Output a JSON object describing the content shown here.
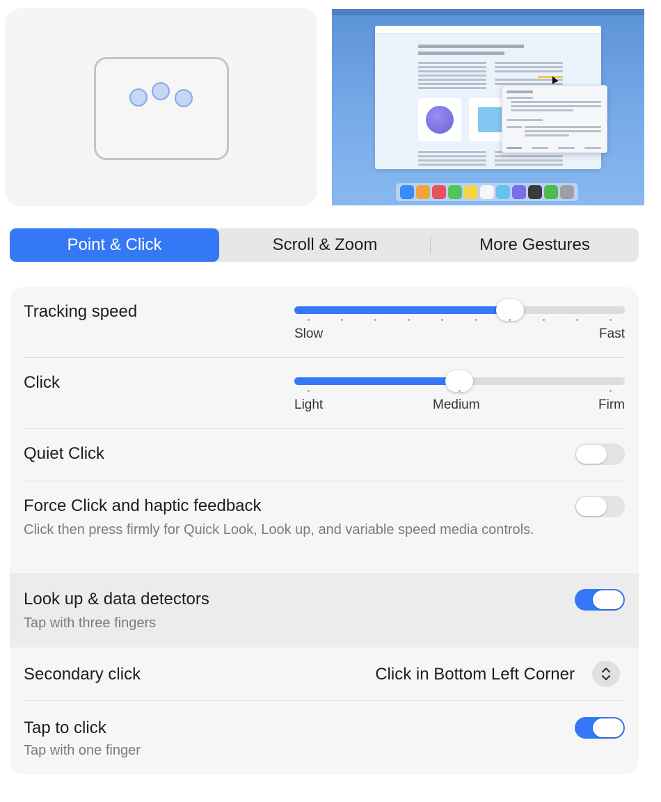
{
  "tabs": [
    {
      "label": "Point & Click",
      "active": true
    },
    {
      "label": "Scroll & Zoom",
      "active": false
    },
    {
      "label": "More Gestures",
      "active": false
    }
  ],
  "colors": {
    "accent": "#3478f6",
    "panel_bg": "#f6f6f6",
    "toggle_off": "#e3e3e3"
  },
  "settings": {
    "tracking_speed": {
      "label": "Tracking speed",
      "min_label": "Slow",
      "max_label": "Fast",
      "value_fraction": 0.65
    },
    "click": {
      "label": "Click",
      "min_label": "Light",
      "mid_label": "Medium",
      "max_label": "Firm",
      "value": "Medium"
    },
    "quiet_click": {
      "label": "Quiet Click",
      "enabled": false
    },
    "force_click": {
      "label": "Force Click and haptic feedback",
      "description": "Click then press firmly for Quick Look, Look up, and variable speed media controls.",
      "enabled": false
    },
    "look_up": {
      "label": "Look up & data detectors",
      "description": "Tap with three fingers",
      "enabled": true
    },
    "secondary_click": {
      "label": "Secondary click",
      "value": "Click in Bottom Left Corner"
    },
    "tap_to_click": {
      "label": "Tap to click",
      "description": "Tap with one finger",
      "enabled": true
    }
  },
  "icons": {
    "popup_stepper": "chevron-up-down-icon",
    "trackpad": "three-finger-trackpad-icon"
  }
}
